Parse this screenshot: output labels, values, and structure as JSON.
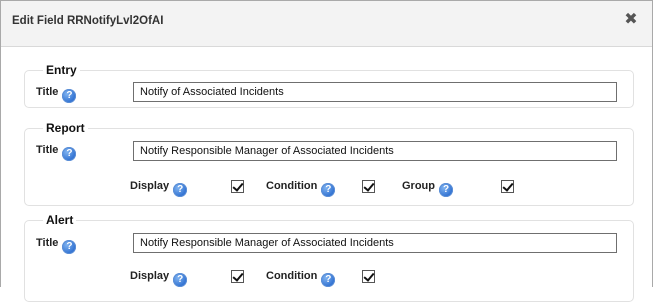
{
  "dialog": {
    "title": "Edit Field RRNotifyLvl2OfAI",
    "close_glyph": "✖"
  },
  "help_glyph": "?",
  "entry": {
    "legend": "Entry",
    "title_label": "Title",
    "title_value": "Notify of Associated Incidents"
  },
  "report": {
    "legend": "Report",
    "title_label": "Title",
    "title_value": "Notify Responsible Manager of Associated Incidents",
    "display_label": "Display",
    "condition_label": "Condition",
    "group_label": "Group",
    "display_checked": true,
    "condition_checked": true,
    "group_checked": true
  },
  "alert": {
    "legend": "Alert",
    "title_label": "Title",
    "title_value": "Notify Responsible Manager of Associated Incidents",
    "display_label": "Display",
    "condition_label": "Condition",
    "display_checked": true,
    "condition_checked": true
  }
}
